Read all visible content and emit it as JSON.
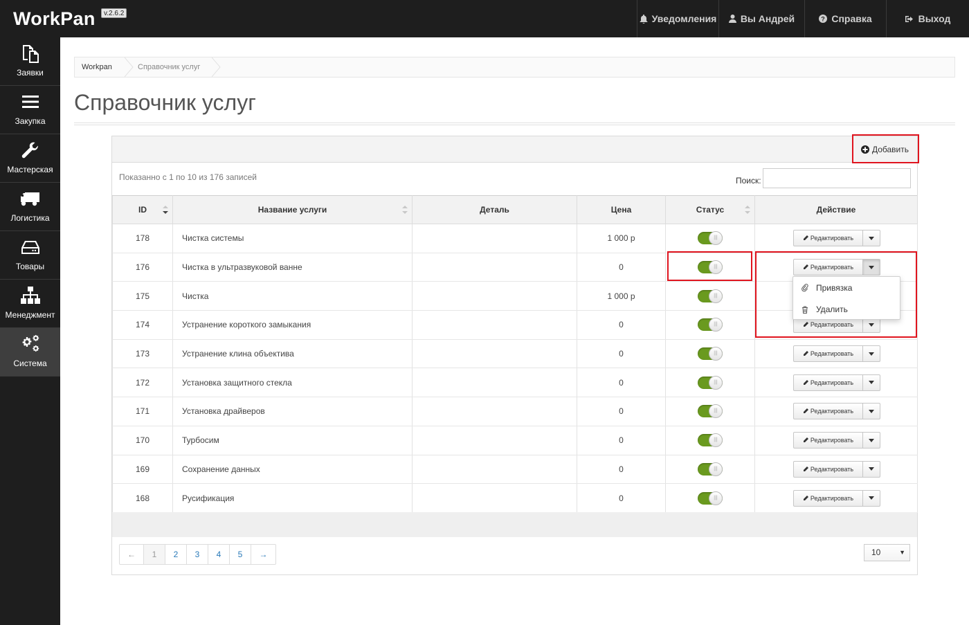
{
  "app": {
    "brand": "WorkPan",
    "version": "v.2.6.2"
  },
  "topnav": [
    {
      "label": "Уведомления",
      "icon": "bell-icon"
    },
    {
      "label": "Вы Андрей",
      "icon": "user-icon"
    },
    {
      "label": "Справка",
      "icon": "question-icon"
    },
    {
      "label": "Выход",
      "icon": "logout-icon"
    }
  ],
  "sidebar": [
    {
      "label": "Заявки",
      "icon": "documents-icon"
    },
    {
      "label": "Закупка",
      "icon": "menu-icon"
    },
    {
      "label": "Мастерская",
      "icon": "wrench-icon"
    },
    {
      "label": "Логистика",
      "icon": "truck-icon"
    },
    {
      "label": "Товары",
      "icon": "drive-icon"
    },
    {
      "label": "Менеджмент",
      "icon": "sitemap-icon"
    },
    {
      "label": "Система",
      "icon": "gears-icon",
      "active": true
    }
  ],
  "breadcrumb": [
    "Workpan",
    "Справочник услуг"
  ],
  "page": {
    "title": "Справочник услуг"
  },
  "panel": {
    "add_label": "Добавить",
    "info": "Показанно с 1 по 10 из 176 записей",
    "search_label": "Поиск:",
    "search_value": ""
  },
  "table": {
    "headers": [
      "ID",
      "Название услуги",
      "Деталь",
      "Цена",
      "Статус",
      "Действие"
    ],
    "edit_label": "Редактировать",
    "rows": [
      {
        "id": "178",
        "name": "Чистка системы",
        "detail": "",
        "price": "1 000 р",
        "status": true
      },
      {
        "id": "176",
        "name": "Чистка в ультразвуковой ванне",
        "detail": "",
        "price": "0",
        "status": true
      },
      {
        "id": "175",
        "name": "Чистка",
        "detail": "",
        "price": "1 000 р",
        "status": true
      },
      {
        "id": "174",
        "name": "Устранение короткого замыкания",
        "detail": "",
        "price": "0",
        "status": true
      },
      {
        "id": "173",
        "name": "Устранение клина объектива",
        "detail": "",
        "price": "0",
        "status": true
      },
      {
        "id": "172",
        "name": "Установка защитного стекла",
        "detail": "",
        "price": "0",
        "status": true
      },
      {
        "id": "171",
        "name": "Установка драйверов",
        "detail": "",
        "price": "0",
        "status": true
      },
      {
        "id": "170",
        "name": "Турбосим",
        "detail": "",
        "price": "0",
        "status": true
      },
      {
        "id": "169",
        "name": "Сохранение данных",
        "detail": "",
        "price": "0",
        "status": true
      },
      {
        "id": "168",
        "name": "Русификация",
        "detail": "",
        "price": "0",
        "status": true
      }
    ]
  },
  "dropdown": {
    "items": [
      "Привязка",
      "Удалить"
    ]
  },
  "pagination": {
    "prev": "←",
    "pages": [
      "1",
      "2",
      "3",
      "4",
      "5"
    ],
    "next": "→",
    "current": "1"
  },
  "page_size": "10",
  "colors": {
    "bar": "#1e1e1e",
    "switch_on": "#6a9a1f",
    "highlight": "#e0141e",
    "link": "#2a7ab9"
  }
}
